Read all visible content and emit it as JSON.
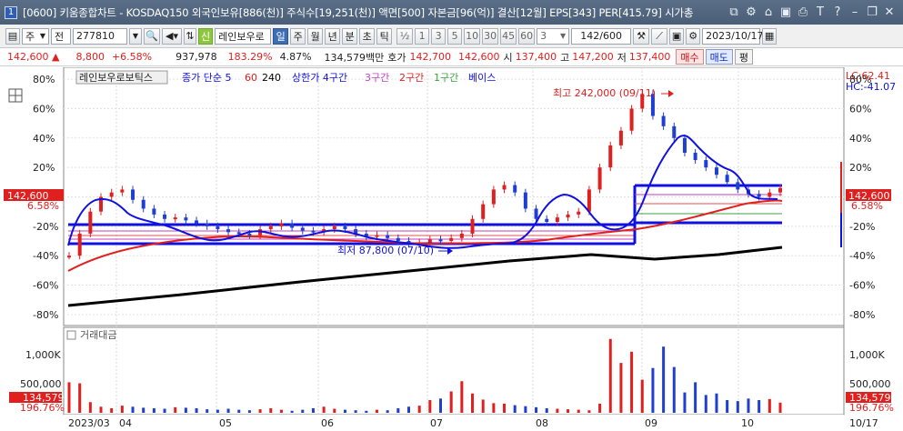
{
  "window": {
    "app_num": "1",
    "title": "[0600] 키움종합차트 - KOSDAQ150 외국인보유[886(천)] 주식수[19,251(천)] 액면[500] 자본금[96(억)] 결산[12월] EPS[343] PER[415.79] 시가총"
  },
  "title_icons": [
    "dock-icon",
    "settings-icon",
    "pin-icon",
    "window-icon",
    "bell-icon",
    "font-icon",
    "help-icon",
    "minimize-icon",
    "restore-icon",
    "close-icon"
  ],
  "toolbar": {
    "market": "주",
    "period_type": "전",
    "code": "277810",
    "stock_name": "레인보우로",
    "badge": "신",
    "periods": [
      "일",
      "주",
      "월",
      "년",
      "분",
      "초",
      "틱"
    ],
    "active_period": "일",
    "fraction": "½",
    "intervals": [
      "1",
      "3",
      "5",
      "10",
      "30",
      "45",
      "60"
    ],
    "interval_value": "3",
    "page_value": "142",
    "page_total": "/600",
    "date": "2023/10/17"
  },
  "quote": {
    "price": "142,600",
    "arrow": "▲",
    "change": "8,800",
    "rate": "+6.58%",
    "volume": "937,978",
    "vol_ratio": "183.29%",
    "turnover": "4.87%",
    "amount": "134,579백만",
    "ask_label": "호가",
    "ask": "142,700",
    "bid": "142,600",
    "open_label": "시",
    "open": "137,400",
    "high_label": "고",
    "high": "147,200",
    "low_label": "저",
    "low": "137,400",
    "buy": "매수",
    "sell": "매도",
    "eval": "평"
  },
  "chart": {
    "legend_name": "레인보우로보틱스",
    "legend_ma": "종가 단순 5",
    "legend_ma2": "60",
    "legend_ma3": "240",
    "legend_zone1": "상한가 4구간",
    "legend_zone2": "3구간",
    "legend_zone3": "2구간",
    "legend_zone4": "1구간",
    "legend_base": "베이스",
    "lc": "LC:62.41",
    "hc": "HC:-41.07",
    "high_note": "최고 242,000 (09/11)",
    "low_note": "최저 87,800 (07/10)",
    "price_tag": "142,600",
    "pct_tag": "6.58%",
    "y_labels": [
      "80%",
      "60%",
      "40%",
      "20%",
      "0%",
      "-20%",
      "-40%",
      "-60%",
      "-80%"
    ],
    "volume_title": "거래대금",
    "vol_labels": [
      "1,000K",
      "500,000"
    ],
    "vol_tag": "134,579",
    "vol_pct": "196.76%",
    "x_labels": [
      "2023/03",
      "04",
      "05",
      "06",
      "07",
      "08",
      "09",
      "10"
    ],
    "x_right": "10/17"
  },
  "chart_data": {
    "type": "candlestick",
    "title": "레인보우로보틱스",
    "y_axis": "% change",
    "ylim": [
      -85,
      85
    ],
    "x_months": [
      "2023/03",
      "04",
      "05",
      "06",
      "07",
      "08",
      "09",
      "10"
    ],
    "price_pct_series": [
      -40,
      -25,
      -10,
      0,
      3,
      5,
      -2,
      -8,
      -12,
      -15,
      -14,
      -16,
      -18,
      -20,
      -22,
      -24,
      -25,
      -26,
      -22,
      -20,
      -18,
      -21,
      -23,
      -24,
      -22,
      -20,
      -22,
      -25,
      -27,
      -26,
      -28,
      -30,
      -32,
      -31,
      -29,
      -30,
      -28,
      -25,
      -15,
      -5,
      5,
      8,
      3,
      -8,
      -15,
      -17,
      -14,
      -12,
      -10,
      5,
      20,
      35,
      45,
      60,
      70,
      55,
      48,
      40,
      30,
      25,
      20,
      15,
      10,
      5,
      2,
      0,
      3,
      6
    ],
    "volume_K": [
      600,
      580,
      210,
      120,
      90,
      140,
      120,
      100,
      90,
      80,
      110,
      100,
      90,
      70,
      60,
      80,
      60,
      50,
      70,
      90,
      60,
      40,
      60,
      90,
      120,
      80,
      60,
      50,
      40,
      60,
      50,
      90,
      120,
      140,
      250,
      280,
      420,
      620,
      380,
      260,
      190,
      180,
      150,
      130,
      110,
      90,
      80,
      70,
      60,
      50,
      180,
      1450,
      980,
      1200,
      650,
      880,
      1300,
      900,
      400,
      600,
      350,
      380,
      250,
      230,
      280,
      250,
      270,
      200
    ]
  }
}
